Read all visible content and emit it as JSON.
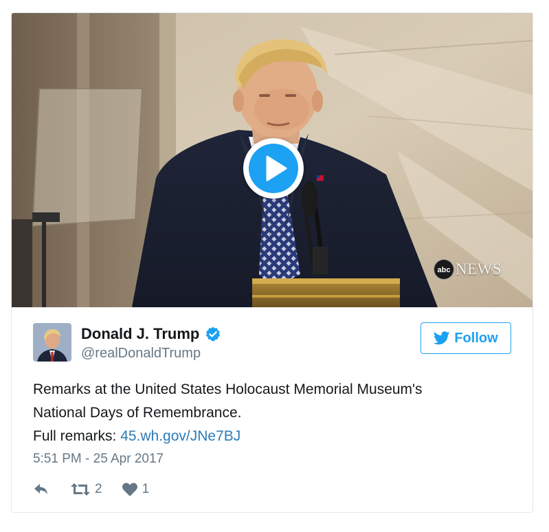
{
  "media": {
    "watermark_logo": "abc",
    "watermark_text": "NEWS",
    "play_icon": "play-icon"
  },
  "author": {
    "name": "Donald J. Trump",
    "handle": "@realDonaldTrump",
    "verified": true,
    "verified_icon": "verified-badge-icon"
  },
  "follow": {
    "label": "Follow",
    "icon": "twitter-bird-icon"
  },
  "tweet": {
    "line1": "Remarks at the United States Holocaust Memorial Museum's",
    "line2": "National Days of Remembrance.",
    "line3_prefix": "Full remarks: ",
    "link_text": "45.wh.gov/JNe7BJ",
    "timestamp": "5:51 PM - 25 Apr 2017"
  },
  "actions": {
    "reply_icon": "reply-icon",
    "retweet_icon": "retweet-icon",
    "retweet_count": "2",
    "like_icon": "heart-icon",
    "like_count": "1"
  },
  "colors": {
    "accent": "#1da1f2",
    "link": "#2b7bb9",
    "secondary_text": "#657786",
    "border": "#e1e8ed"
  }
}
